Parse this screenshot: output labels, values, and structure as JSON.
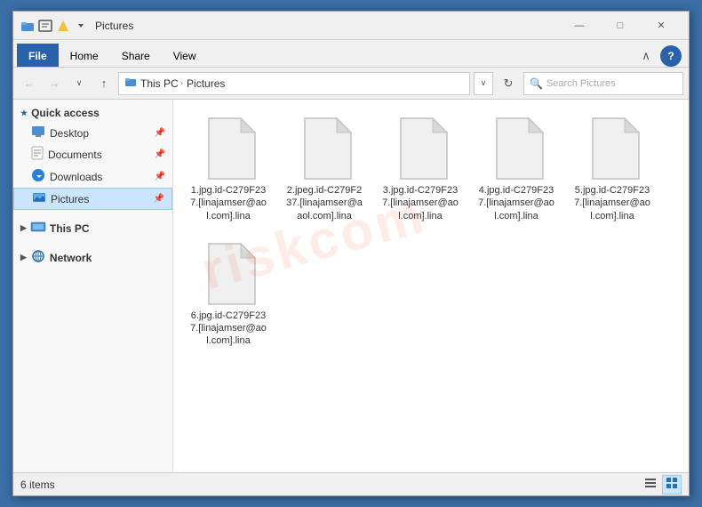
{
  "window": {
    "title": "Pictures",
    "controls": {
      "minimize": "—",
      "maximize": "□",
      "close": "✕"
    }
  },
  "ribbon": {
    "tabs": [
      "File",
      "Home",
      "Share",
      "View"
    ],
    "active_tab": "File",
    "chevron_label": "∧",
    "help_label": "?"
  },
  "addressbar": {
    "back_icon": "←",
    "forward_icon": "→",
    "dropdown_icon": "∨",
    "up_icon": "↑",
    "path": [
      "This PC",
      "Pictures"
    ],
    "refresh_icon": "↻",
    "search_placeholder": "Search Pictures"
  },
  "sidebar": {
    "quick_access_label": "Quick access",
    "items": [
      {
        "label": "Desktop",
        "pinned": true,
        "icon": "desktop"
      },
      {
        "label": "Documents",
        "pinned": true,
        "icon": "documents"
      },
      {
        "label": "Downloads",
        "pinned": true,
        "icon": "downloads"
      },
      {
        "label": "Pictures",
        "pinned": true,
        "icon": "pictures",
        "active": true
      }
    ],
    "this_pc_label": "This PC",
    "network_label": "Network"
  },
  "files": [
    {
      "name": "1.jpg.id-C279F23\n7.[linajamser@ao\nl.com].lina"
    },
    {
      "name": "2.jpeg.id-C279F2\n37.[linajamser@a\naol.com].lina"
    },
    {
      "name": "3.jpg.id-C279F23\n7.[linajamser@ao\nl.com].lina"
    },
    {
      "name": "4.jpg.id-C279F23\n7.[linajamser@ao\nl.com].lina"
    },
    {
      "name": "5.jpg.id-C279F23\n7.[linajamser@ao\nl.com].lina"
    },
    {
      "name": "6.jpg.id-C279F23\n7.[linajamser@ao\nl.com].lina"
    }
  ],
  "statusbar": {
    "count_label": "6 items",
    "view_list_icon": "☰",
    "view_large_icon": "⊞"
  }
}
